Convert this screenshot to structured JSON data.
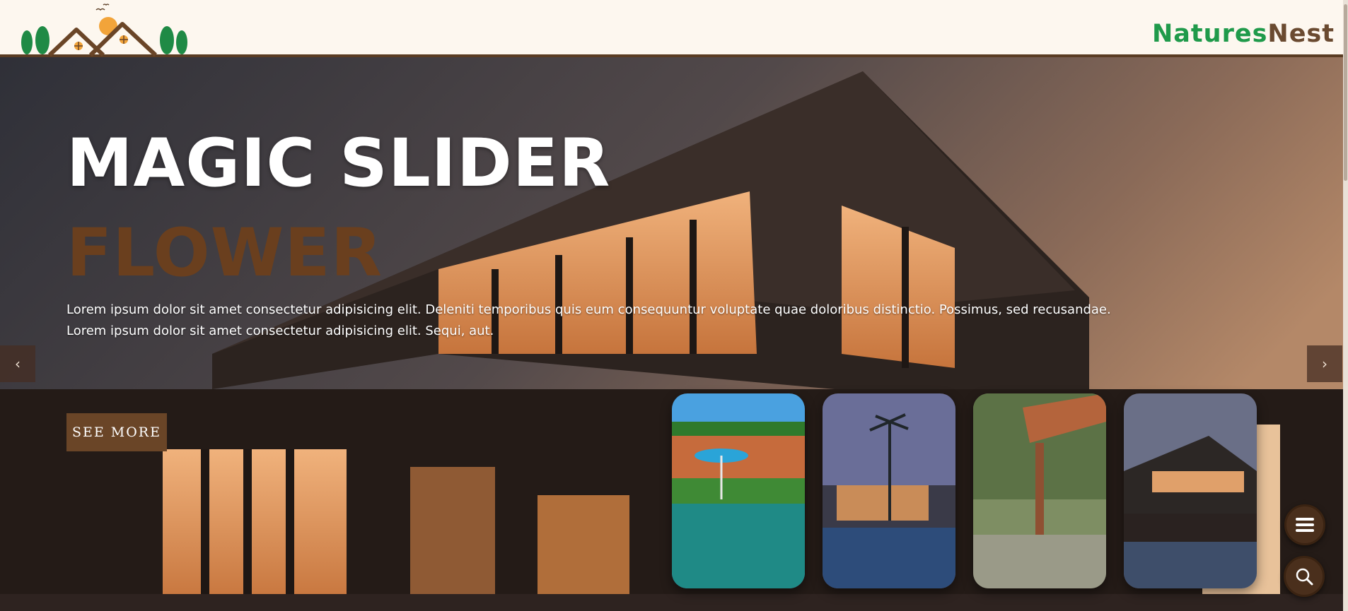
{
  "header": {
    "brand_part1": "Natures",
    "brand_part2": "Nest",
    "logo_icon": "house-trees-logo-icon"
  },
  "hero": {
    "title": "MAGIC SLIDER",
    "subtitle": "FLOWER",
    "description_line1": "Lorem ipsum dolor sit amet consectetur adipisicing elit. Deleniti temporibus quis eum consequuntur voluptate quae doloribus distinctio. Possimus, sed recusandae.",
    "description_line2": "Lorem ipsum dolor sit amet consectetur adipisicing elit. Sequi, aut.",
    "button_label": "SEE MORE",
    "prev_arrow": "‹",
    "next_arrow": "›"
  },
  "thumbnails": [
    {
      "subject": "resort pool with umbrellas"
    },
    {
      "subject": "palm trees pool at dusk"
    },
    {
      "subject": "garden pergola"
    },
    {
      "subject": "modern house by pool"
    }
  ],
  "fabs": {
    "menu_icon": "hamburger-menu-icon",
    "search_icon": "search-icon"
  },
  "colors": {
    "brand_green": "#1f9a4a",
    "brand_brown": "#6a4a30",
    "accent_brown": "#6a4527",
    "header_bg": "#fdf7ef"
  }
}
